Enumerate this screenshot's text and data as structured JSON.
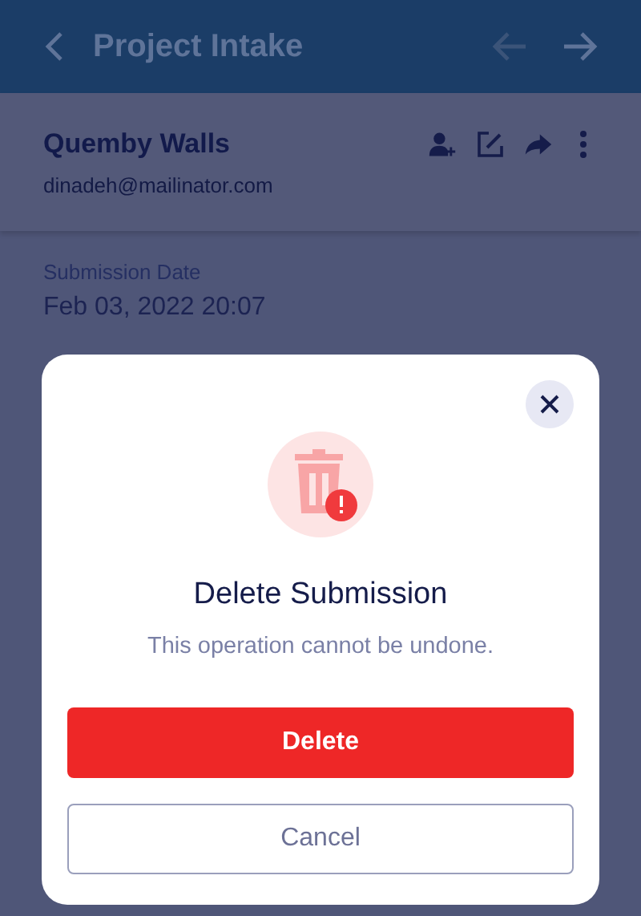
{
  "header": {
    "title": "Project Intake"
  },
  "submitter": {
    "name": "Quemby Walls",
    "email": "dinadeh@mailinator.com"
  },
  "fields": [
    {
      "label": "Submission Date",
      "value": "Feb 03, 2022 20:07"
    }
  ],
  "dialog": {
    "title": "Delete Submission",
    "message": "This operation cannot be undone.",
    "buttons": [
      {
        "label": "Delete",
        "kind": "primary"
      },
      {
        "label": "Cancel",
        "kind": "secondary"
      }
    ]
  }
}
